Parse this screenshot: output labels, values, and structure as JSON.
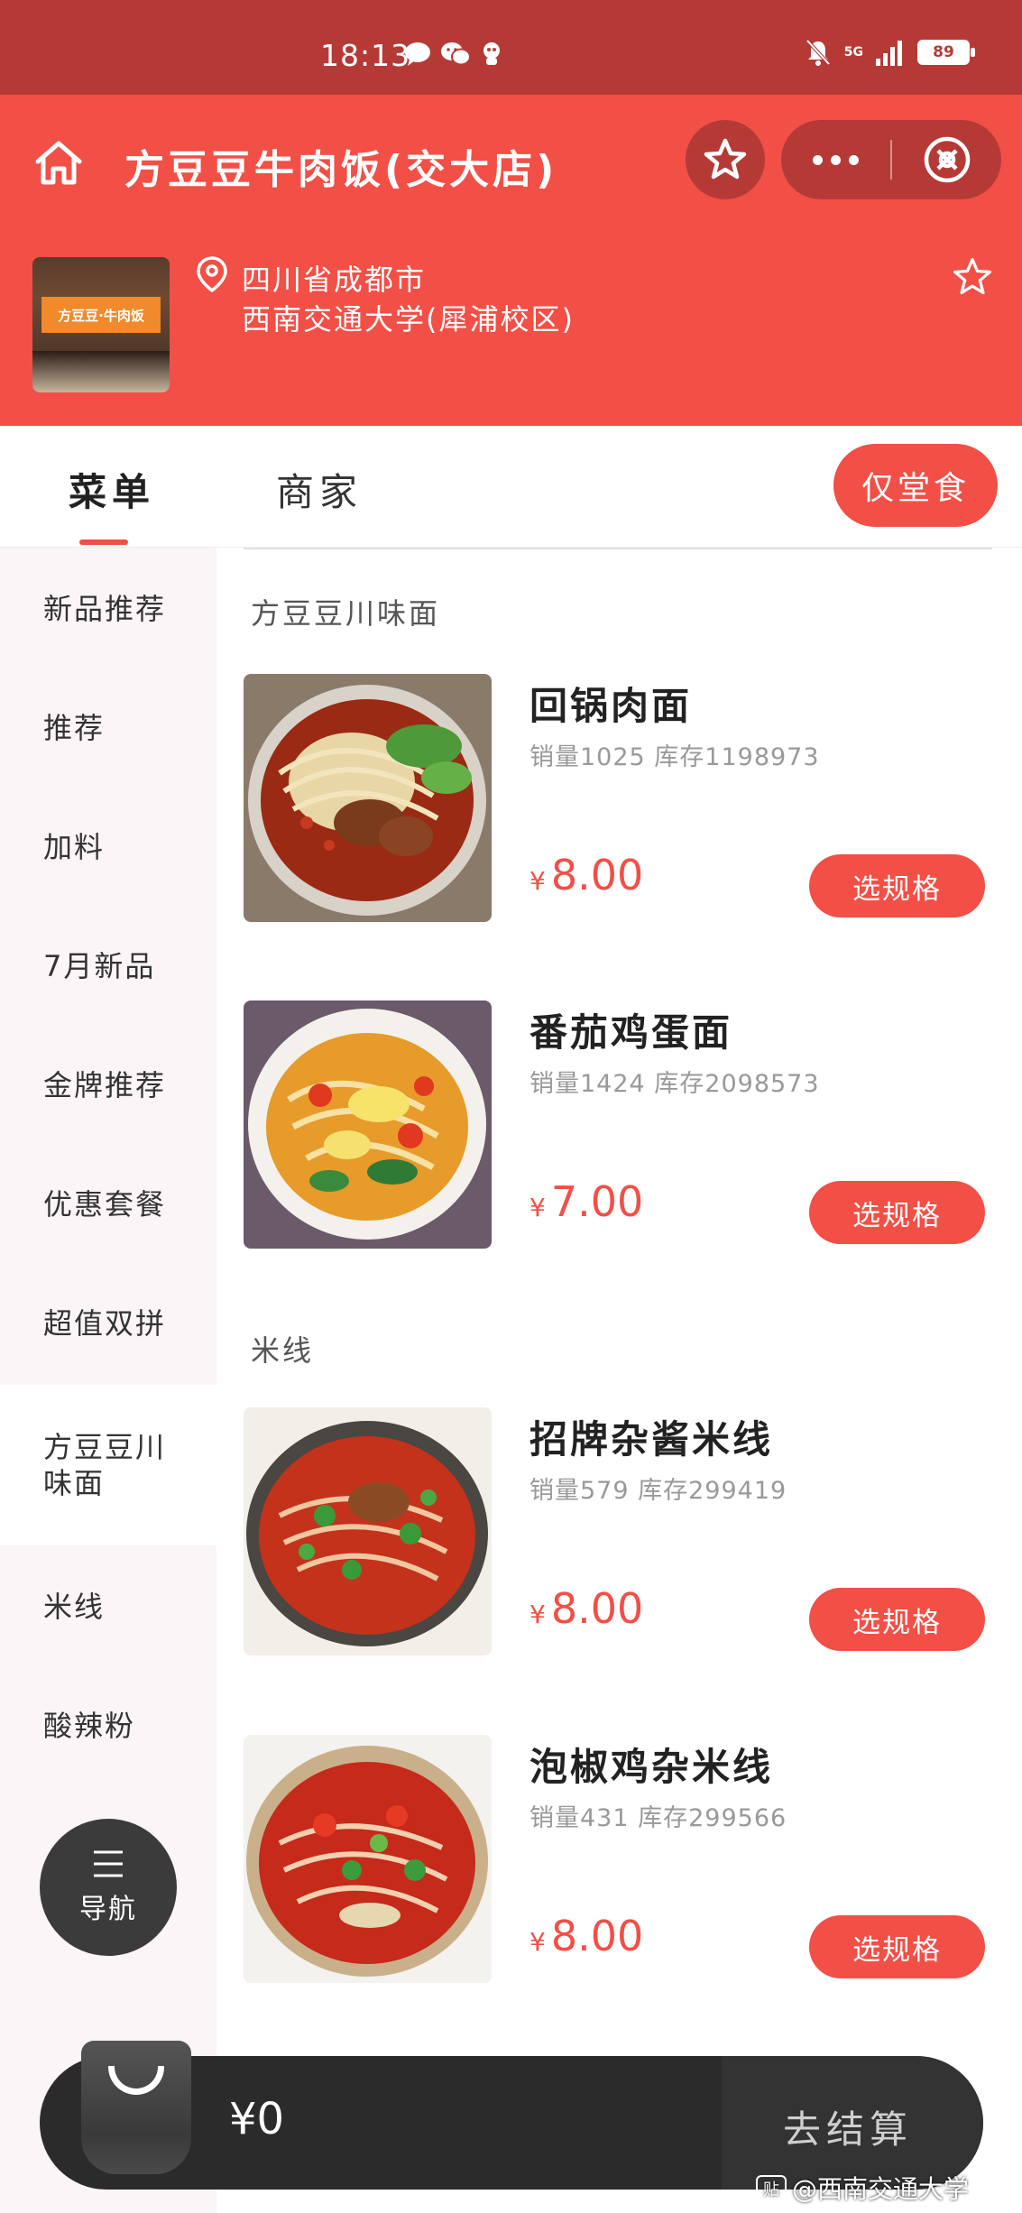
{
  "status_bar": {
    "time": "18:13",
    "network": "5G",
    "battery": "89"
  },
  "header": {
    "title": "方豆豆牛肉饭(交大店)",
    "store_sign": "方豆豆·牛肉饭",
    "address_line1": "四川省成都市",
    "address_line2": "西南交通大学(犀浦校区)"
  },
  "tabs": {
    "menu": "菜单",
    "merchant": "商家",
    "dine_in": "仅堂食"
  },
  "sidebar": {
    "items": [
      {
        "label": "新品推荐"
      },
      {
        "label": "推荐"
      },
      {
        "label": "加料"
      },
      {
        "label": "7月新品"
      },
      {
        "label": "金牌推荐"
      },
      {
        "label": "优惠套餐"
      },
      {
        "label": "超值双拼"
      },
      {
        "label": "方豆豆川\n味面"
      },
      {
        "label": "米线"
      },
      {
        "label": "酸辣粉"
      }
    ],
    "active_index": 7
  },
  "sections": [
    {
      "title": "方豆豆川味面",
      "dishes": [
        {
          "name": "回锅肉面",
          "stats": "销量1025 库存1198973",
          "currency": "¥",
          "price": "8.00",
          "button": "选规格"
        },
        {
          "name": "番茄鸡蛋面",
          "stats": "销量1424 库存2098573",
          "currency": "¥",
          "price": "7.00",
          "button": "选规格"
        }
      ]
    },
    {
      "title": "米线",
      "dishes": [
        {
          "name": "招牌杂酱米线",
          "stats": "销量579 库存299419",
          "currency": "¥",
          "price": "8.00",
          "button": "选规格"
        },
        {
          "name": "泡椒鸡杂米线",
          "stats": "销量431 库存299566",
          "currency": "¥",
          "price": "8.00",
          "button": "选规格"
        }
      ]
    }
  ],
  "float_nav": {
    "label": "导航"
  },
  "cart": {
    "total": "¥0",
    "checkout": "去结算"
  },
  "watermark": {
    "badge": "贴",
    "text": "@西南交通大学"
  },
  "colors": {
    "brand": "#f24f46",
    "status_bar": "#b53a36",
    "sidebar_bg": "#fbf5f7",
    "cart_bg": "#2b2b2b"
  }
}
